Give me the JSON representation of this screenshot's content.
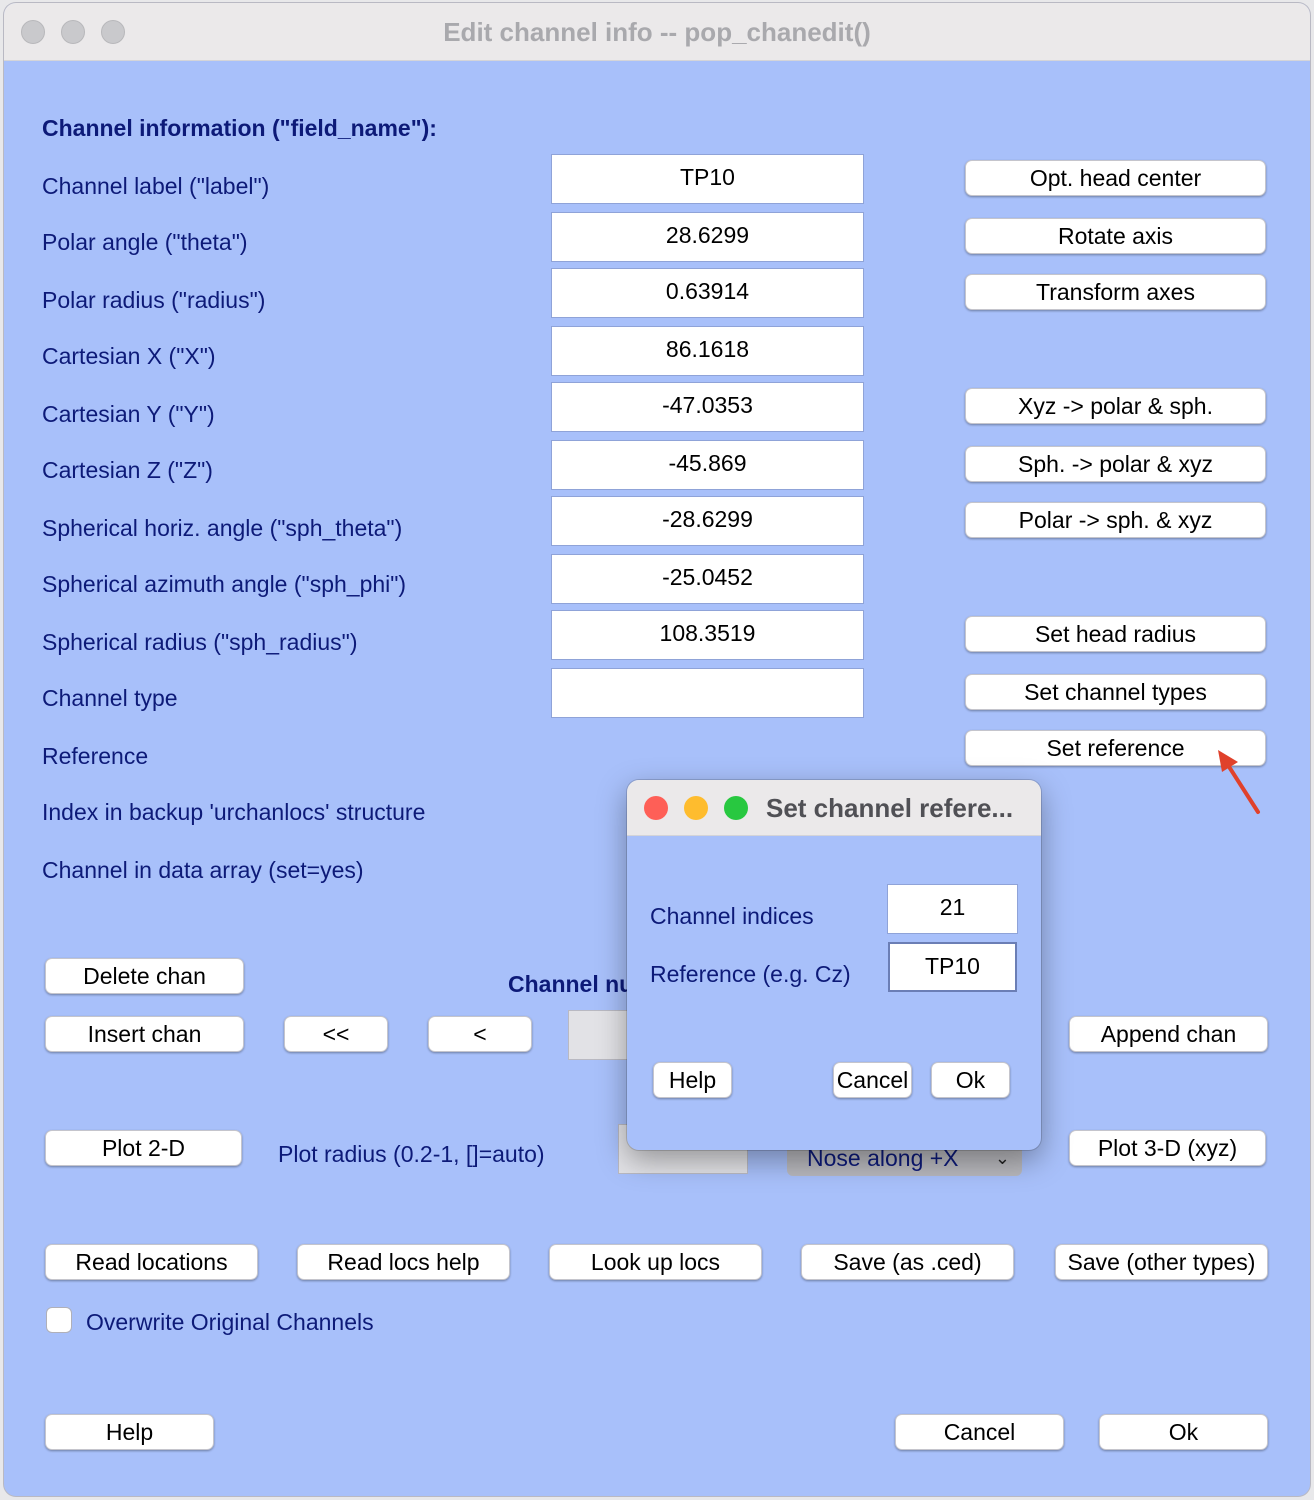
{
  "window": {
    "title": "Edit channel info -- pop_chanedit()"
  },
  "header": "Channel information (\"field_name\"):",
  "fields": [
    {
      "label": "Channel label (\"label\")",
      "value": "TP10"
    },
    {
      "label": "Polar angle (\"theta\")",
      "value": "28.6299"
    },
    {
      "label": "Polar radius (\"radius\")",
      "value": "0.63914"
    },
    {
      "label": "Cartesian X (\"X\")",
      "value": "86.1618"
    },
    {
      "label": "Cartesian Y (\"Y\")",
      "value": "-47.0353"
    },
    {
      "label": "Cartesian Z (\"Z\")",
      "value": "-45.869"
    },
    {
      "label": "Spherical horiz. angle (\"sph_theta\")",
      "value": "-28.6299"
    },
    {
      "label": "Spherical azimuth angle (\"sph_phi\")",
      "value": "-25.0452"
    },
    {
      "label": "Spherical radius (\"sph_radius\")",
      "value": "108.3519"
    },
    {
      "label": "Channel type",
      "value": ""
    },
    {
      "label": "Reference"
    },
    {
      "label": "Index in backup 'urchanlocs' structure"
    },
    {
      "label": "Channel in data array (set=yes)"
    }
  ],
  "side_buttons": {
    "opt_head_center": "Opt. head center",
    "rotate_axis": "Rotate axis",
    "transform_axes": "Transform axes",
    "xyz_to_polar": "Xyz -> polar & sph.",
    "sph_to_polar": "Sph. -> polar & xyz",
    "polar_to_sph": "Polar -> sph. & xyz",
    "set_head_radius": "Set head radius",
    "set_channel_types": "Set channel types",
    "set_reference": "Set reference"
  },
  "nav": {
    "delete_chan": "Delete chan",
    "insert_chan": "Insert chan",
    "first": "<<",
    "prev": "<",
    "channel_number_label": "Channel nu",
    "append_chan": "Append chan"
  },
  "plot": {
    "plot2d": "Plot 2-D",
    "radius_label": "Plot radius (0.2-1, []=auto)",
    "nose_select": "Nose along +X",
    "plot3d": "Plot 3-D (xyz)"
  },
  "file_buttons": {
    "read_locations": "Read locations",
    "read_locs_help": "Read locs help",
    "look_up_locs": "Look up locs",
    "save_ced": "Save (as .ced)",
    "save_other": "Save (other types)"
  },
  "overwrite": {
    "label": "Overwrite Original Channels",
    "checked": false
  },
  "bottom": {
    "help": "Help",
    "cancel": "Cancel",
    "ok": "Ok"
  },
  "dialog": {
    "title": "Set channel refere...",
    "channel_indices_label": "Channel indices",
    "channel_indices_value": "21",
    "reference_label": "Reference (e.g. Cz)",
    "reference_value": "TP10",
    "help": "Help",
    "cancel": "Cancel",
    "ok": "Ok"
  },
  "colors": {
    "window_bg": "#a8c0fa",
    "label_text": "#0d1a78",
    "close": "#fe5f57",
    "minimize": "#febc2e",
    "zoom": "#28c840",
    "arrow": "#e0412b"
  }
}
